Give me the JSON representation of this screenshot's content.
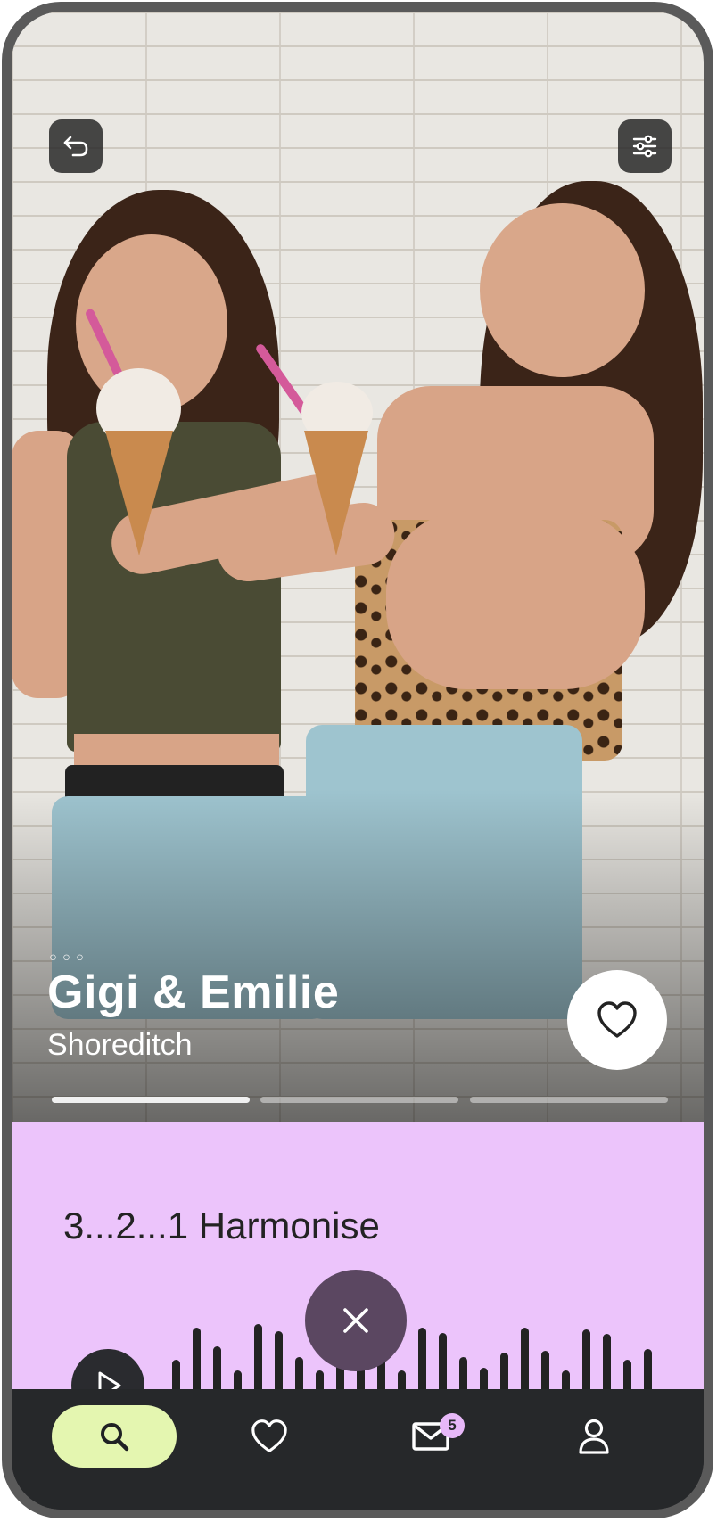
{
  "profile": {
    "more_dots": "◦◦◦",
    "name": "Gigi & Emilie",
    "location": "Shoreditch",
    "photo_count": 3,
    "active_photo": 1
  },
  "prompt": {
    "title": "3...2...1 Harmonise",
    "waveform": [
      0.32,
      0.62,
      0.44,
      0.22,
      0.65,
      0.58,
      0.34,
      0.22,
      0.52,
      0.56,
      0.36,
      0.22,
      0.62,
      0.57,
      0.34,
      0.24,
      0.38,
      0.62,
      0.4,
      0.22,
      0.6,
      0.56,
      0.32,
      0.42
    ]
  },
  "nav": {
    "messages_badge": "5",
    "active": "search"
  },
  "colors": {
    "card_bg": "#ecc4fb",
    "nav_bg": "#26282a",
    "search_pill": "#e4f6b0",
    "close_button": "#5b4761"
  },
  "icons": {
    "back": "back-arrow-icon",
    "filters": "sliders-icon",
    "like": "heart-icon",
    "play": "play-icon",
    "close": "close-icon",
    "search": "search-icon",
    "likes": "heart-outline-icon",
    "messages": "mail-icon",
    "profile": "user-icon"
  }
}
